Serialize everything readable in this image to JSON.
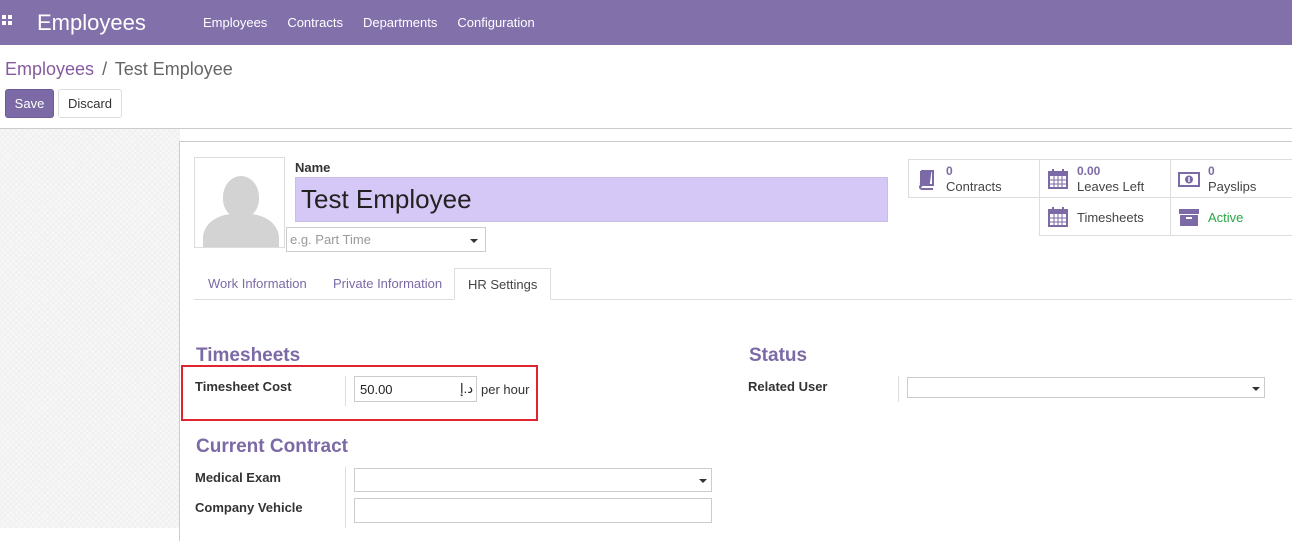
{
  "topbar": {
    "app_title": "Employees",
    "menu": [
      "Employees",
      "Contracts",
      "Departments",
      "Configuration"
    ]
  },
  "breadcrumb": {
    "parent": "Employees",
    "separator": "/",
    "current": "Test Employee"
  },
  "buttons": {
    "save": "Save",
    "discard": "Discard"
  },
  "employee": {
    "name_label": "Name",
    "name": "Test Employee",
    "job_placeholder": "e.g. Part Time"
  },
  "stats": {
    "contracts": {
      "value": "0",
      "label": "Contracts",
      "icon": "book-icon"
    },
    "leaves": {
      "value": "0.00",
      "label": "Leaves Left",
      "icon": "calendar-icon"
    },
    "payslips": {
      "value": "0",
      "label": "Payslips",
      "icon": "money-icon"
    },
    "timesheets": {
      "label": "Timesheets",
      "icon": "calendar-icon"
    },
    "active": {
      "label": "Active",
      "icon": "archive-icon"
    }
  },
  "tabs": [
    "Work Information",
    "Private Information",
    "HR Settings"
  ],
  "timesheets": {
    "title": "Timesheets",
    "cost_label": "Timesheet Cost",
    "cost_value": "50.00",
    "currency": "د.إ",
    "unit": "per hour"
  },
  "status": {
    "title": "Status",
    "related_user_label": "Related User"
  },
  "current_contract": {
    "title": "Current Contract",
    "medical_exam_label": "Medical Exam",
    "company_vehicle_label": "Company Vehicle"
  },
  "colors": {
    "brand": "#8270ab",
    "accent": "#7c6aa6",
    "active_green": "#28a745",
    "highlight": "#e0242f"
  }
}
